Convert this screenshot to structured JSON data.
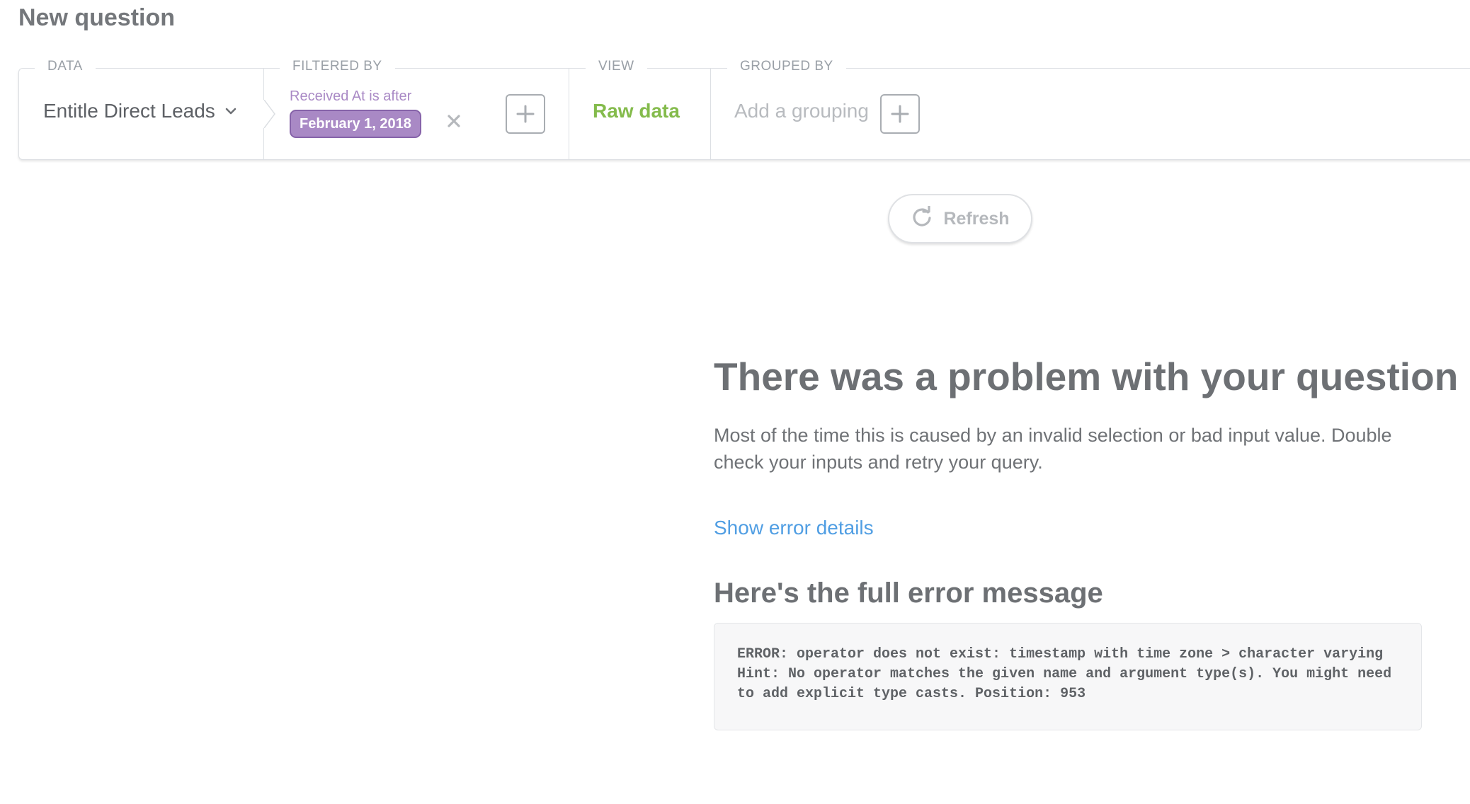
{
  "page": {
    "title": "New question"
  },
  "query_builder": {
    "data": {
      "label": "DATA",
      "table": "Entitle Direct Leads"
    },
    "filter": {
      "label": "FILTERED BY",
      "caption": "Received At is after",
      "value": "February 1, 2018"
    },
    "view": {
      "label": "VIEW",
      "value": "Raw data"
    },
    "grouping": {
      "label": "GROUPED BY",
      "placeholder": "Add a grouping"
    }
  },
  "refresh": {
    "label": "Refresh"
  },
  "error": {
    "title": "There was a problem with your question",
    "description": "Most of the time this is caused by an invalid selection or bad input value. Double check your inputs and retry your query.",
    "details_link": "Show error details",
    "subtitle": "Here's the full error message",
    "message": "ERROR: operator does not exist: timestamp with time zone > character varying Hint: No operator matches the given name and argument type(s). You might need to add explicit type casts. Position: 953"
  },
  "colors": {
    "filter_purple": "#a989c5",
    "raw_data_green": "#84bb4c",
    "link_blue": "#509ee3"
  }
}
